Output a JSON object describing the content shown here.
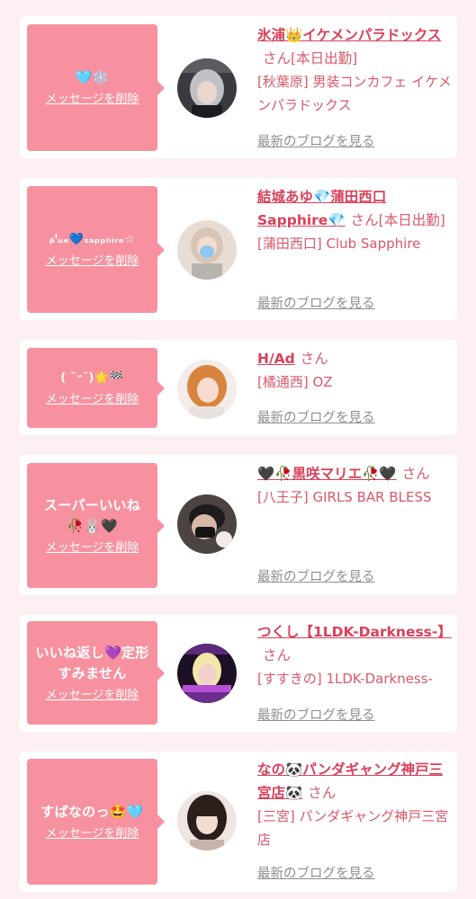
{
  "colors": {
    "bubble": "#f8919f",
    "name": "#d9405a",
    "text": "#d9596b",
    "blog_link": "#8f8f8f",
    "background": "#fdf0f3"
  },
  "delete_label": "メッセージを削除",
  "blog_label": "最新のブログを見る",
  "honorific": "さん",
  "items": [
    {
      "message": "🩵❄️",
      "name": "氷浦👑イケメンパラドックス",
      "status": "[本日出勤]",
      "location": "[秋葉原] 男装コンカフェ イケメンパラドックス",
      "avatar_icon": "avatar-silver-hair-icon"
    },
    {
      "message": "ᵦˡᵤₑ💙ₛₐₚₚₕᵢᵣₑ☆",
      "name": "結城あゆ💎蒲田西口Sapphire💎",
      "status": "[本日出勤]",
      "location": "[蒲田西口] Club Sapphire",
      "avatar_icon": "avatar-blue-mask-icon"
    },
    {
      "message": "( ˘ᵕ˘)🌟🏁",
      "name": "H/Ad",
      "status": "",
      "location": "[橘通西] OZ",
      "avatar_icon": "avatar-orange-hair-icon"
    },
    {
      "message": "スーパーいいね🥀🐰🖤",
      "name": "🖤🥀黒咲マリエ🥀🖤",
      "status": "",
      "location": "[八王子] GIRLS BAR BLESS",
      "avatar_icon": "avatar-black-mask-icon"
    },
    {
      "message": "いいね返し💜定形すみません",
      "name": "つくし【1LDK-Darkness-】",
      "status": "",
      "location": "[すすきの] 1LDK-Darkness-",
      "avatar_icon": "avatar-neon-icon"
    },
    {
      "message": "すばなのっ🤩🩵",
      "name": "なの🐼パンダギャング神戸三宮店🐼",
      "status": "",
      "location": "[三宮] パンダギャング神戸三宮店",
      "avatar_icon": "avatar-dark-hair-icon"
    }
  ]
}
